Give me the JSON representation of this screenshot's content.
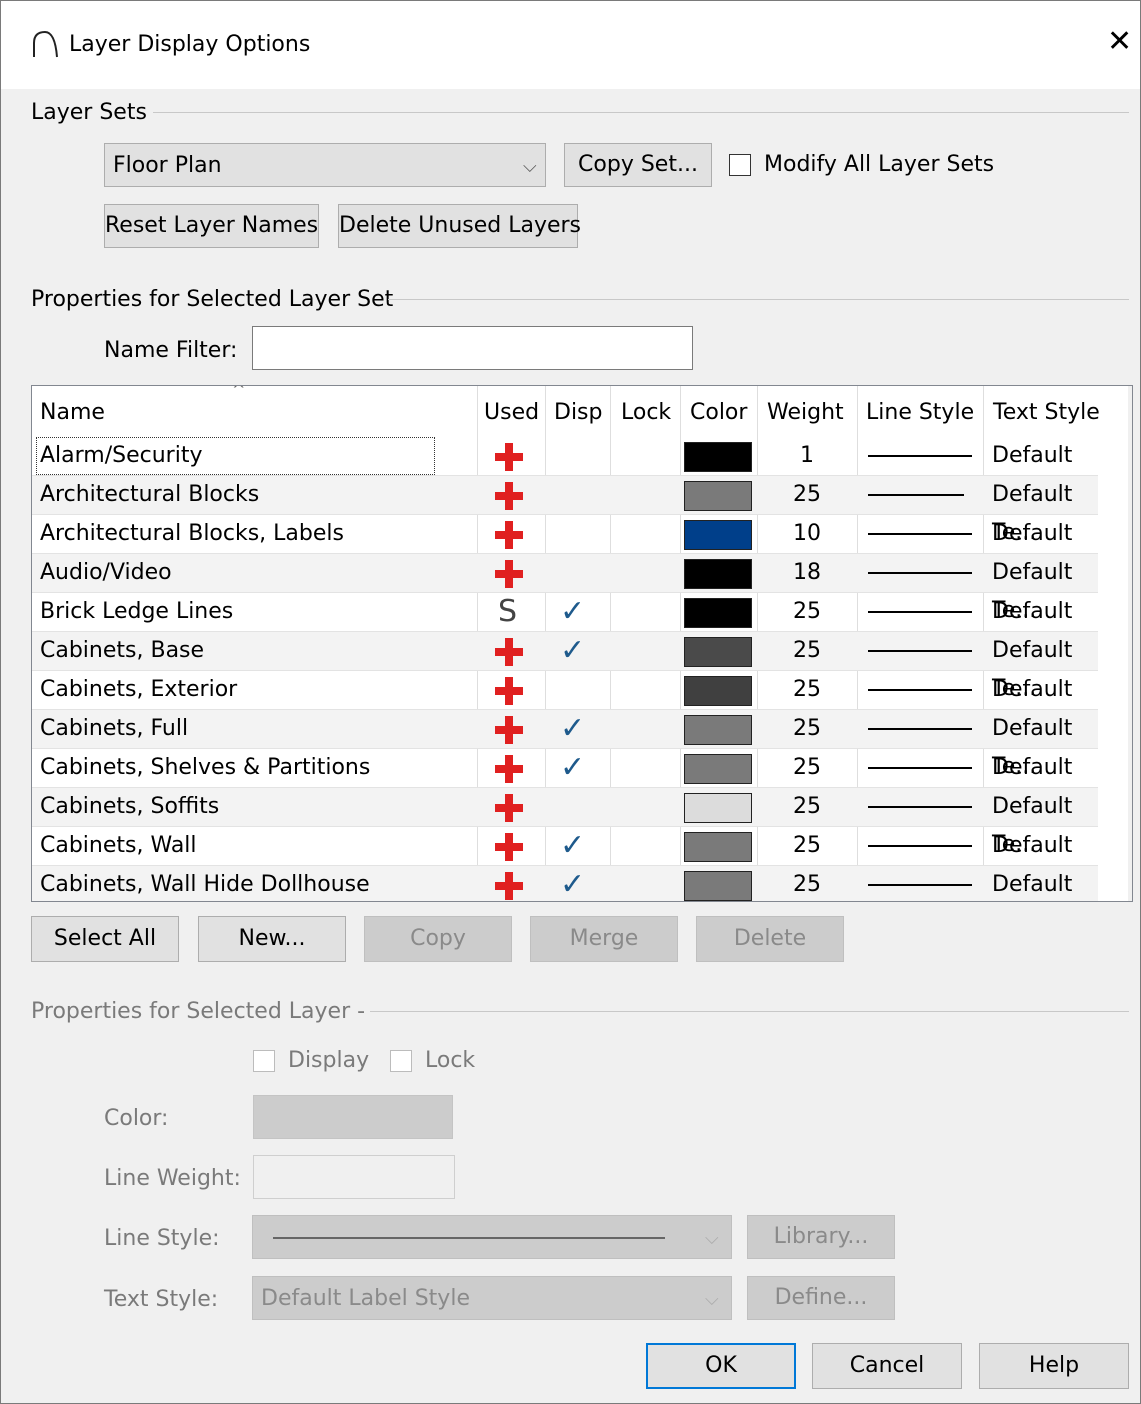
{
  "window": {
    "title": "Layer Display Options",
    "close_glyph": "✕"
  },
  "layer_sets": {
    "group_label": "Layer Sets",
    "selected_set": "Floor Plan",
    "copy_set_label": "Copy Set...",
    "modify_all_label": "Modify All Layer Sets",
    "reset_names_label": "Reset Layer Names",
    "delete_unused_label": "Delete Unused Layers"
  },
  "selected_set_props": {
    "group_label": "Properties for Selected Layer Set",
    "name_filter_label": "Name Filter:",
    "name_filter_value": ""
  },
  "table": {
    "columns": [
      "Name",
      "Used",
      "Disp",
      "Lock",
      "Color",
      "Weight",
      "Line Style",
      "Text Style"
    ],
    "rows": [
      {
        "name": "Alarm/Security",
        "used": "plus",
        "disp": false,
        "color": "#000000",
        "weight": "1",
        "text_style": "Default Te..."
      },
      {
        "name": "Architectural Blocks",
        "used": "plus",
        "disp": false,
        "color": "#7a7a7a",
        "weight": "25",
        "text_style": "Default Te..."
      },
      {
        "name": "Architectural Blocks, Labels",
        "used": "plus",
        "disp": false,
        "color": "#003f8a",
        "weight": "10",
        "text_style": "Default ..."
      },
      {
        "name": "Audio/Video",
        "used": "plus",
        "disp": false,
        "color": "#000000",
        "weight": "18",
        "text_style": "Default Te..."
      },
      {
        "name": "Brick Ledge Lines",
        "used": "S",
        "disp": true,
        "color": "#000000",
        "weight": "25",
        "text_style": "Default Te..."
      },
      {
        "name": "Cabinets,  Base",
        "used": "plus",
        "disp": true,
        "color": "#4a4a4a",
        "weight": "25",
        "text_style": "Default Te..."
      },
      {
        "name": "Cabinets,  Exterior",
        "used": "plus",
        "disp": false,
        "color": "#404040",
        "weight": "25",
        "text_style": "Default Te..."
      },
      {
        "name": "Cabinets,  Full",
        "used": "plus",
        "disp": true,
        "color": "#7a7a7a",
        "weight": "25",
        "text_style": "Default Te..."
      },
      {
        "name": "Cabinets,  Shelves & Partitions",
        "used": "plus",
        "disp": true,
        "color": "#7a7a7a",
        "weight": "25",
        "text_style": "Default Te..."
      },
      {
        "name": "Cabinets,  Soffits",
        "used": "plus",
        "disp": false,
        "color": "#dcdcdc",
        "weight": "25",
        "text_style": "Default Te..."
      },
      {
        "name": "Cabinets,  Wall",
        "used": "plus",
        "disp": true,
        "color": "#7a7a7a",
        "weight": "25",
        "text_style": "Default Te..."
      },
      {
        "name": "Cabinets,  Wall Hide Dollhouse",
        "used": "plus",
        "disp": true,
        "color": "#7a7a7a",
        "weight": "25",
        "text_style": "Default Te..."
      }
    ],
    "used_s_glyph": "S",
    "disp_check_glyph": "✓"
  },
  "actions": {
    "select_all": "Select All",
    "new": "New...",
    "copy": "Copy",
    "merge": "Merge",
    "delete": "Delete"
  },
  "selected_layer_props": {
    "group_label": "Properties for Selected Layer -",
    "display_label": "Display",
    "lock_label": "Lock",
    "color_label": "Color:",
    "line_weight_label": "Line Weight:",
    "line_style_label": "Line Style:",
    "library_label": "Library...",
    "text_style_label": "Text Style:",
    "text_style_value": "Default Label Style",
    "define_label": "Define..."
  },
  "footer": {
    "ok": "OK",
    "cancel": "Cancel",
    "help": "Help"
  }
}
